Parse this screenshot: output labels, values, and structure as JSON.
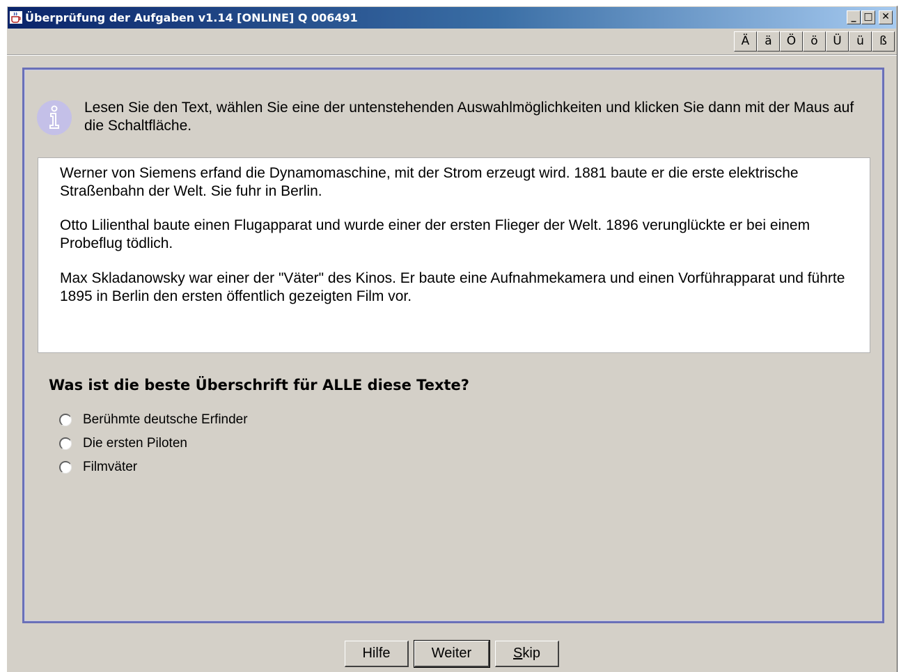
{
  "window": {
    "title": "Überprüfung der Aufgaben v1.14  [ONLINE] Q 006491",
    "controls": {
      "minimize": "_",
      "maximize": "□",
      "close": "✕"
    }
  },
  "umlauts": [
    "Ä",
    "ä",
    "Ö",
    "ö",
    "Ü",
    "ü",
    "ß"
  ],
  "instruction": "Lesen Sie den Text, wählen Sie eine der untenstehenden Auswahlmöglichkeiten und klicken Sie dann mit der Maus auf die Schaltfläche.",
  "passage": [
    "Werner von Siemens erfand die Dynamomaschine, mit der Strom erzeugt wird. 1881 baute er die erste elektrische Straßenbahn der Welt. Sie fuhr in Berlin.",
    "Otto Lilienthal baute einen Flugapparat und wurde einer der ersten Flieger der Welt. 1896 verunglückte er bei einem Probeflug tödlich.",
    "Max Skladanowsky war einer der \"Väter\" des Kinos. Er baute eine Aufnahmekamera und einen Vorführapparat und führte 1895 in Berlin den ersten öffentlich gezeigten Film vor."
  ],
  "question": "Was ist die beste Überschrift für ALLE diese Texte?",
  "options": [
    "Berühmte deutsche Erfinder",
    "Die ersten Piloten",
    "Filmväter"
  ],
  "buttons": {
    "help": "Hilfe",
    "next": "Weiter",
    "skip_mnemonic": "S",
    "skip_rest": "kip"
  },
  "icons": {
    "app": "java-cup-icon",
    "info": "info-icon"
  }
}
